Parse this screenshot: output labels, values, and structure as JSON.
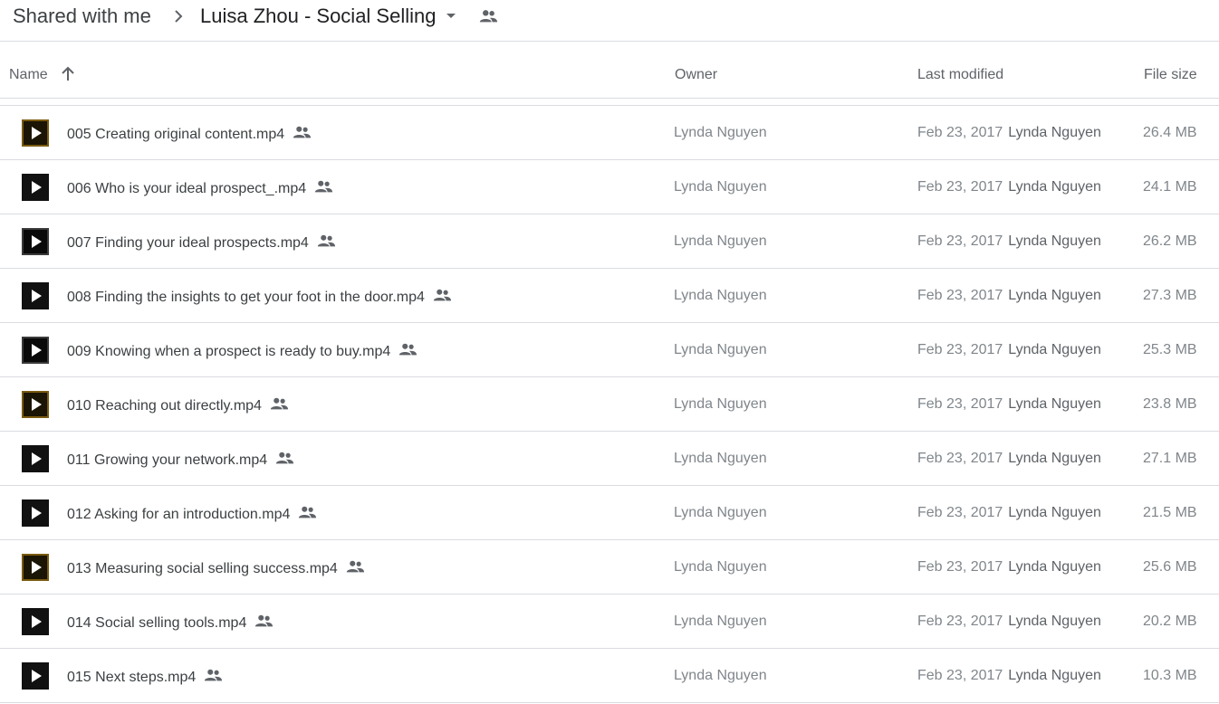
{
  "breadcrumb": {
    "root": "Shared with me",
    "current": "Luisa Zhou - Social Selling"
  },
  "columns": {
    "name": "Name",
    "owner": "Owner",
    "last_modified": "Last modified",
    "file_size": "File size"
  },
  "files": [
    {
      "name": "005 Creating original content.mp4",
      "owner": "Lynda Nguyen",
      "modified_date": "Feb 23, 2017",
      "modified_by": "Lynda Nguyen",
      "size": "26.4 MB",
      "thumb": "gold"
    },
    {
      "name": "006 Who is your ideal prospect_.mp4",
      "owner": "Lynda Nguyen",
      "modified_date": "Feb 23, 2017",
      "modified_by": "Lynda Nguyen",
      "size": "24.1 MB",
      "thumb": "black"
    },
    {
      "name": "007 Finding your ideal prospects.mp4",
      "owner": "Lynda Nguyen",
      "modified_date": "Feb 23, 2017",
      "modified_by": "Lynda Nguyen",
      "size": "26.2 MB",
      "thumb": "dark"
    },
    {
      "name": "008 Finding the insights to get your foot in the door.mp4",
      "owner": "Lynda Nguyen",
      "modified_date": "Feb 23, 2017",
      "modified_by": "Lynda Nguyen",
      "size": "27.3 MB",
      "thumb": "black"
    },
    {
      "name": "009 Knowing when a prospect is ready to buy.mp4",
      "owner": "Lynda Nguyen",
      "modified_date": "Feb 23, 2017",
      "modified_by": "Lynda Nguyen",
      "size": "25.3 MB",
      "thumb": "dark"
    },
    {
      "name": "010 Reaching out directly.mp4",
      "owner": "Lynda Nguyen",
      "modified_date": "Feb 23, 2017",
      "modified_by": "Lynda Nguyen",
      "size": "23.8 MB",
      "thumb": "gold"
    },
    {
      "name": "011 Growing your network.mp4",
      "owner": "Lynda Nguyen",
      "modified_date": "Feb 23, 2017",
      "modified_by": "Lynda Nguyen",
      "size": "27.1 MB",
      "thumb": "black"
    },
    {
      "name": "012 Asking for an introduction.mp4",
      "owner": "Lynda Nguyen",
      "modified_date": "Feb 23, 2017",
      "modified_by": "Lynda Nguyen",
      "size": "21.5 MB",
      "thumb": "black"
    },
    {
      "name": "013 Measuring social selling success.mp4",
      "owner": "Lynda Nguyen",
      "modified_date": "Feb 23, 2017",
      "modified_by": "Lynda Nguyen",
      "size": "25.6 MB",
      "thumb": "gold"
    },
    {
      "name": "014 Social selling tools.mp4",
      "owner": "Lynda Nguyen",
      "modified_date": "Feb 23, 2017",
      "modified_by": "Lynda Nguyen",
      "size": "20.2 MB",
      "thumb": "black"
    },
    {
      "name": "015 Next steps.mp4",
      "owner": "Lynda Nguyen",
      "modified_date": "Feb 23, 2017",
      "modified_by": "Lynda Nguyen",
      "size": "10.3 MB",
      "thumb": "black"
    }
  ]
}
